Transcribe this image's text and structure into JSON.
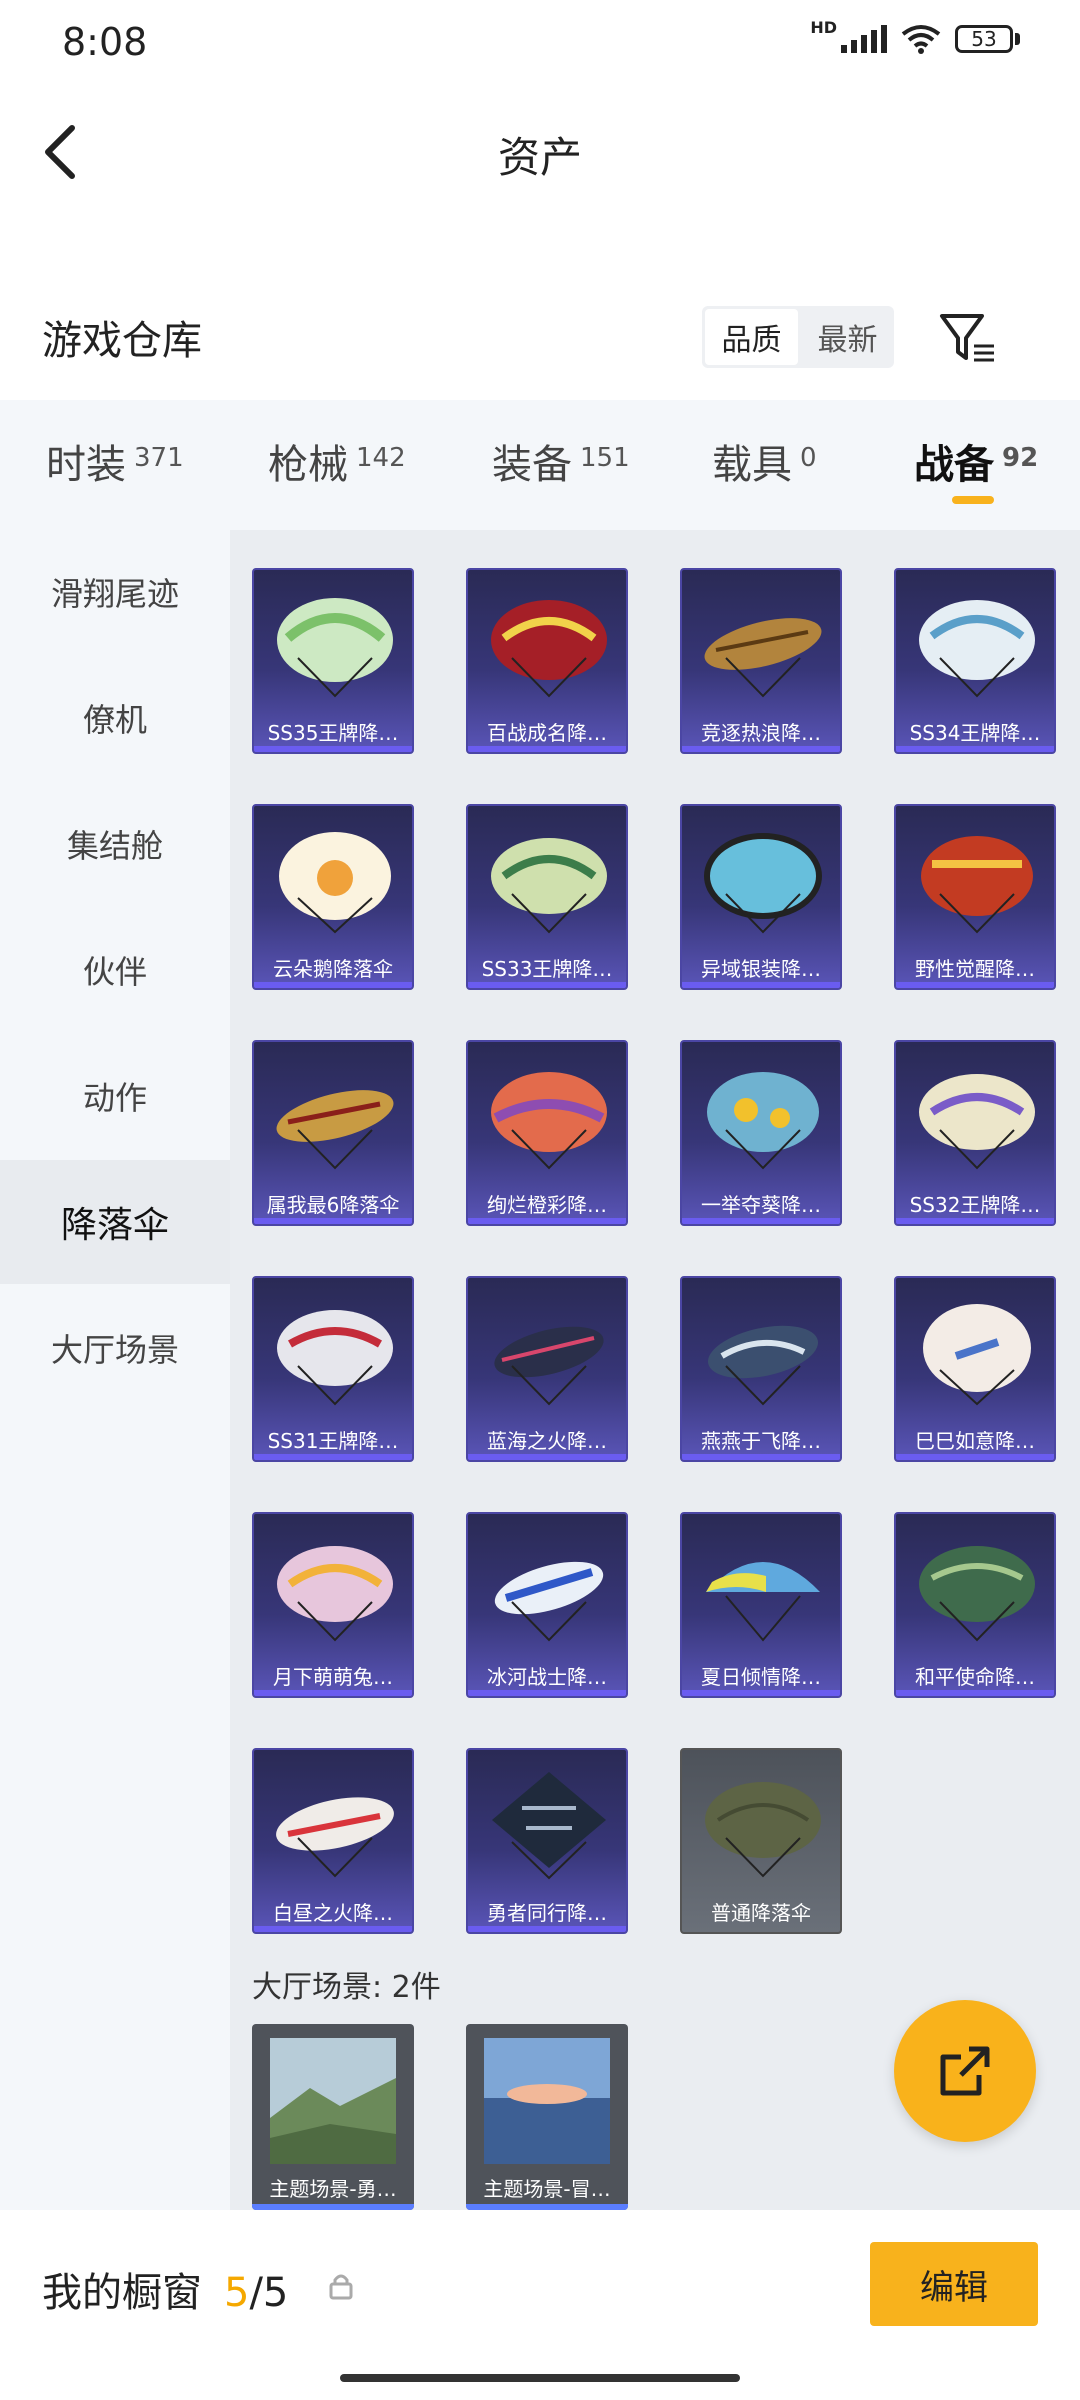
{
  "status": {
    "time": "8:08",
    "battery": "53",
    "hd": "HD"
  },
  "header": {
    "title": "资产"
  },
  "warehouse": {
    "title": "游戏仓库",
    "sort_quality": "品质",
    "sort_newest": "最新"
  },
  "tabs": [
    {
      "label": "时装",
      "count": "371"
    },
    {
      "label": "枪械",
      "count": "142"
    },
    {
      "label": "装备",
      "count": "151"
    },
    {
      "label": "载具",
      "count": "0"
    },
    {
      "label": "战备",
      "count": "92"
    }
  ],
  "sidebar": [
    "滑翔尾迹",
    "僚机",
    "集结舱",
    "伙伴",
    "动作",
    "降落伞",
    "大厅场景"
  ],
  "items": [
    "SS35王牌降…",
    "百战成名降…",
    "竞逐热浪降…",
    "SS34王牌降…",
    "云朵鹅降落伞",
    "SS33王牌降…",
    "异域银装降…",
    "野性觉醒降…",
    "属我最6降落伞",
    "绚烂橙彩降…",
    "一举夺葵降…",
    "SS32王牌降…",
    "SS31王牌降…",
    "蓝海之火降…",
    "燕燕于飞降…",
    "巳巳如意降…",
    "月下萌萌兔…",
    "冰河战士降…",
    "夏日倾情降…",
    "和平使命降…",
    "白昼之火降…",
    "勇者同行降…",
    "普通降落伞"
  ],
  "scene_section": {
    "label": "大厅场景: 2件",
    "items": [
      "主题场景-勇…",
      "主题场景-冒…"
    ]
  },
  "bottom": {
    "showcase_label": "我的橱窗",
    "current": "5",
    "total": "/5",
    "edit": "编辑"
  },
  "colors": {
    "accent": "#f8b21c",
    "card_purple": "#373678"
  }
}
